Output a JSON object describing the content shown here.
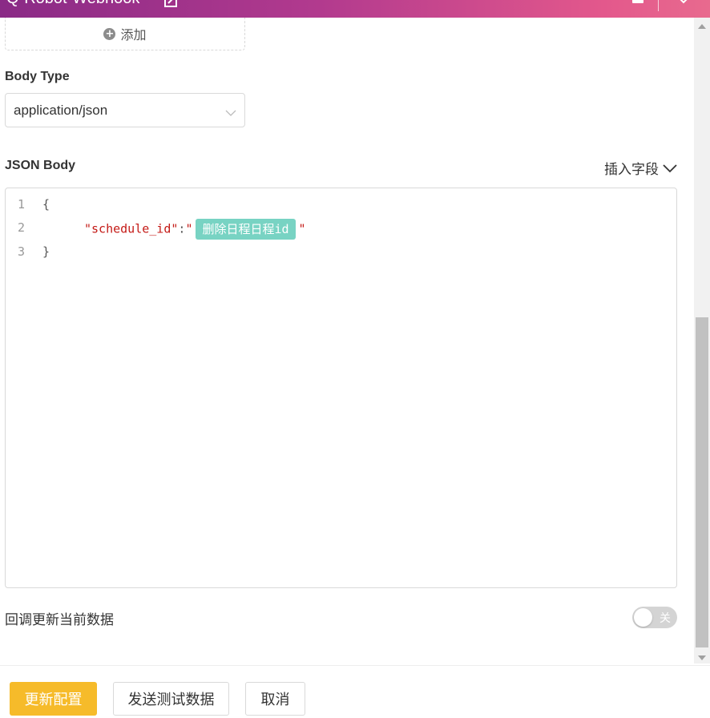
{
  "window": {
    "title": "Q-Robot-Webhook"
  },
  "headers": {
    "add_label": "添加"
  },
  "body_type": {
    "label": "Body Type",
    "value": "application/json"
  },
  "json_body": {
    "label": "JSON Body",
    "insert_field_label": "插入字段",
    "lines": [
      {
        "num": "1",
        "text": "{"
      },
      {
        "num": "2",
        "key": "\"schedule_id\"",
        "colon": ":",
        "open_quote": "\"",
        "tag": "删除日程日程id",
        "close_quote": "\""
      },
      {
        "num": "3",
        "text": "}"
      }
    ]
  },
  "callback": {
    "label": "回调更新当前数据",
    "toggle_state": "关"
  },
  "footer": {
    "update_label": "更新配置",
    "send_test_label": "发送测试数据",
    "cancel_label": "取消"
  },
  "colors": {
    "primary": "#f6bb2a",
    "tag": "#78d3c3",
    "header_gradient_start": "#8a2a86",
    "header_gradient_end": "#e86a8e"
  }
}
